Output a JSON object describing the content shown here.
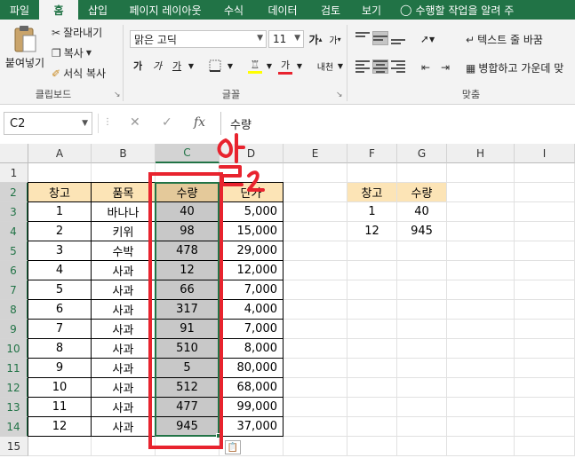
{
  "ribbon_tabs": [
    "파일",
    "홈",
    "삽입",
    "페이지 레이아웃",
    "수식",
    "데이터",
    "검토",
    "보기"
  ],
  "active_tab": "홈",
  "tell_me": "수행할 작업을 알려 주",
  "clipboard": {
    "paste_label": "붙여넣기",
    "cut_label": "잘라내기",
    "copy_label": "복사",
    "format_painter_label": "서식 복사",
    "group_label": "클립보드"
  },
  "font": {
    "font_name": "맑은 고딕",
    "font_size": "11",
    "grow_label": "가",
    "shrink_label": "가",
    "bold_label": "가",
    "italic_label": "가",
    "underline_label": "가",
    "font_color_label": "가",
    "phonetic_label": "내천",
    "group_label": "글꼴"
  },
  "alignment": {
    "wrap_text_label": "텍스트 줄 바꿈",
    "merge_label": "병합하고 가운데 맞",
    "group_label": "맞춤"
  },
  "formula_bar": {
    "name_box": "C2",
    "fx_label": "fx",
    "value": "수량"
  },
  "columns": [
    "A",
    "B",
    "C",
    "D",
    "E",
    "F",
    "G",
    "H",
    "I"
  ],
  "rows": [
    "1",
    "2",
    "3",
    "4",
    "5",
    "6",
    "7",
    "8",
    "9",
    "10",
    "11",
    "12",
    "13",
    "14",
    "15"
  ],
  "main_table": {
    "headers": [
      "창고",
      "품목",
      "수량",
      "단가"
    ],
    "rows": [
      [
        "1",
        "바나나",
        "40",
        "5,000"
      ],
      [
        "2",
        "키위",
        "98",
        "15,000"
      ],
      [
        "3",
        "수박",
        "478",
        "29,000"
      ],
      [
        "4",
        "사과",
        "12",
        "12,000"
      ],
      [
        "5",
        "사과",
        "66",
        "7,000"
      ],
      [
        "6",
        "사과",
        "317",
        "4,000"
      ],
      [
        "7",
        "사과",
        "91",
        "7,000"
      ],
      [
        "8",
        "사과",
        "510",
        "8,000"
      ],
      [
        "9",
        "사과",
        "5",
        "80,000"
      ],
      [
        "10",
        "사과",
        "512",
        "68,000"
      ],
      [
        "11",
        "사과",
        "477",
        "99,000"
      ],
      [
        "12",
        "사과",
        "945",
        "37,000"
      ]
    ]
  },
  "side_table": {
    "headers": [
      "창고",
      "수량"
    ],
    "rows": [
      [
        "1",
        "40"
      ],
      [
        "12",
        "945"
      ]
    ]
  },
  "handwriting": "열2",
  "colors": {
    "excel_green": "#217346",
    "header_fill": "#fce4b6",
    "selected_fill": "#c8c8c8",
    "annotation_red": "#e8232e"
  }
}
